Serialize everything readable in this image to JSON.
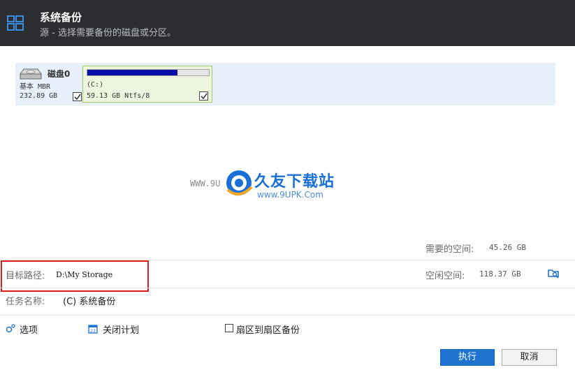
{
  "header": {
    "title": "系统备份",
    "subtitle": "源 - 选择需要备份的磁盘或分区。"
  },
  "disk": {
    "name": "磁盘0",
    "type": "基本 MBR",
    "size": "232.89 GB",
    "checked": true,
    "partition": {
      "label": "(C:)",
      "size": "59.13 GB Ntfs/8",
      "usage_fraction": 0.74,
      "checked": true
    }
  },
  "watermark": {
    "url_left": "WWW.9U",
    "title": "久友下载站",
    "url": "www.9UPK.Com"
  },
  "space": {
    "needed_label": "需要的空间:",
    "needed_value": "45.26 GB",
    "free_label": "空闲空间:",
    "free_value": "118.37 GB"
  },
  "target": {
    "label": "目标路径:",
    "value": "D:\\My Storage"
  },
  "task": {
    "label": "任务名称:",
    "value": "(C) 系统备份"
  },
  "options": {
    "options_label": "选项",
    "schedule_label": "关闭计划",
    "sector_label": "扇区到扇区备份"
  },
  "buttons": {
    "execute": "执行",
    "cancel": "取消"
  },
  "colors": {
    "header_bg": "#2b2d31",
    "accent": "#1e73d1",
    "highlight": "#e01b1b",
    "bar_fill": "#0a10a5"
  }
}
